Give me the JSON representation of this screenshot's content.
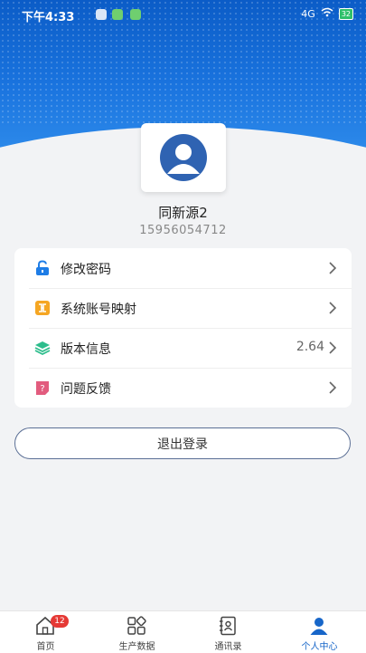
{
  "status_bar": {
    "time": "下午4:33",
    "network": "4G",
    "battery": "32"
  },
  "profile": {
    "name": "同新源2",
    "phone": "15956054712"
  },
  "menu": [
    {
      "label": "修改密码",
      "icon": "lock-icon",
      "value": ""
    },
    {
      "label": "系统账号映射",
      "icon": "mapping-icon",
      "value": ""
    },
    {
      "label": "版本信息",
      "icon": "layers-icon",
      "value": "2.64"
    },
    {
      "label": "问题反馈",
      "icon": "feedback-icon",
      "value": ""
    }
  ],
  "logout_label": "退出登录",
  "tabs": [
    {
      "label": "首页",
      "icon": "home-icon",
      "badge": "12"
    },
    {
      "label": "生产数据",
      "icon": "grid-icon"
    },
    {
      "label": "通讯录",
      "icon": "contacts-icon"
    },
    {
      "label": "个人中心",
      "icon": "person-icon",
      "active": true
    }
  ],
  "colors": {
    "primary": "#1766c9",
    "header_blue": "#1a74df",
    "badge_red": "#e53935"
  }
}
